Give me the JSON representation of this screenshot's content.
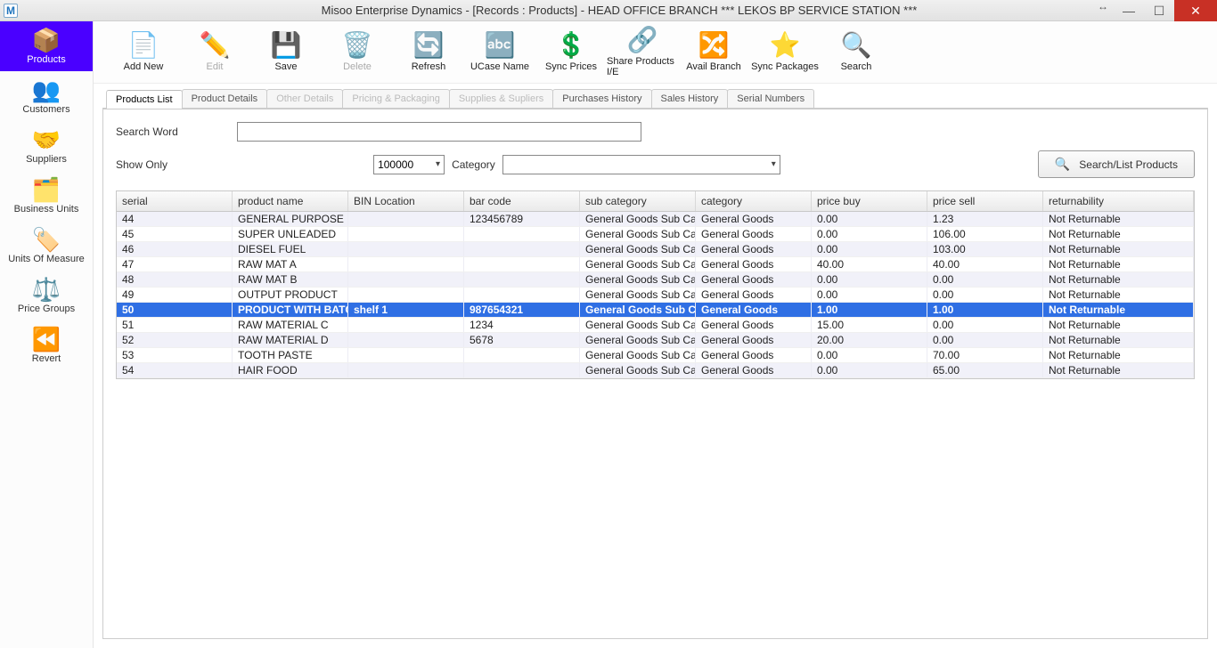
{
  "title": "Misoo Enterprise Dynamics - [Records : Products] - HEAD OFFICE BRANCH *** LEKOS BP SERVICE STATION ***",
  "sidebar": {
    "items": [
      {
        "label": "Products",
        "icon": "📦",
        "active": true
      },
      {
        "label": "Customers",
        "icon": "👥"
      },
      {
        "label": "Suppliers",
        "icon": "🤝"
      },
      {
        "label": "Business Units",
        "icon": "🗂️"
      },
      {
        "label": "Units Of Measure",
        "icon": "🏷️"
      },
      {
        "label": "Price Groups",
        "icon": "⚖️"
      },
      {
        "label": "Revert",
        "icon": "⏪"
      }
    ]
  },
  "toolbar": {
    "items": [
      {
        "label": "Add New",
        "icon": "📄",
        "accent": "#2fa52f"
      },
      {
        "label": "Edit",
        "icon": "✏️",
        "disabled": true
      },
      {
        "label": "Save",
        "icon": "💾"
      },
      {
        "label": "Delete",
        "icon": "🗑️",
        "disabled": true
      },
      {
        "label": "Refresh",
        "icon": "🔄"
      },
      {
        "label": "UCase  Name",
        "icon": "🔤"
      },
      {
        "label": "Sync Prices",
        "icon": "💲"
      },
      {
        "label": "Share Products I/E",
        "icon": "🔗"
      },
      {
        "label": "Avail Branch",
        "icon": "🔀"
      },
      {
        "label": "Sync Packages",
        "icon": "⭐"
      },
      {
        "label": "Search",
        "icon": "🔍"
      }
    ]
  },
  "tabs": [
    {
      "label": "Products List",
      "active": true
    },
    {
      "label": "Product Details"
    },
    {
      "label": "Other Details",
      "disabled": true
    },
    {
      "label": "Pricing & Packaging",
      "disabled": true
    },
    {
      "label": "Supplies & Supliers",
      "disabled": true
    },
    {
      "label": "Purchases History"
    },
    {
      "label": "Sales History"
    },
    {
      "label": "Serial Numbers"
    }
  ],
  "search": {
    "word_label": "Search Word",
    "show_only_label": "Show Only",
    "show_only_value": "100000",
    "category_label": "Category",
    "category_value": "",
    "button_label": "Search/List Products"
  },
  "columns": [
    "serial",
    "product name",
    "BIN Location",
    "bar code",
    "sub category",
    "category",
    "price buy",
    "price sell",
    "returnability"
  ],
  "rows": [
    {
      "serial": "44",
      "name": "GENERAL PURPOSE INK",
      "bin": "",
      "bar": "123456789",
      "sub": "General Goods Sub Cat...",
      "cat": "General Goods",
      "buy": "0.00",
      "sell": "1.23",
      "ret": "Not Returnable"
    },
    {
      "serial": "45",
      "name": "SUPER UNLEADED",
      "bin": "",
      "bar": "",
      "sub": "General Goods Sub Cat...",
      "cat": "General Goods",
      "buy": "0.00",
      "sell": "106.00",
      "ret": "Not Returnable"
    },
    {
      "serial": "46",
      "name": "DIESEL FUEL",
      "bin": "",
      "bar": "",
      "sub": "General Goods Sub Cat...",
      "cat": "General Goods",
      "buy": "0.00",
      "sell": "103.00",
      "ret": "Not Returnable"
    },
    {
      "serial": "47",
      "name": "RAW MAT A",
      "bin": "",
      "bar": "",
      "sub": "General Goods Sub Cat...",
      "cat": "General Goods",
      "buy": "40.00",
      "sell": "40.00",
      "ret": "Not Returnable"
    },
    {
      "serial": "48",
      "name": "RAW MAT B",
      "bin": "",
      "bar": "",
      "sub": "General Goods Sub Cat...",
      "cat": "General Goods",
      "buy": "0.00",
      "sell": "0.00",
      "ret": "Not Returnable"
    },
    {
      "serial": "49",
      "name": "OUTPUT PRODUCT",
      "bin": "",
      "bar": "",
      "sub": "General Goods Sub Cat...",
      "cat": "General Goods",
      "buy": "0.00",
      "sell": "0.00",
      "ret": "Not Returnable"
    },
    {
      "serial": "50",
      "name": "PRODUCT WITH BATCH",
      "bin": "shelf 1",
      "bar": "987654321",
      "sub": "General Goods Sub C...",
      "cat": "General Goods",
      "buy": "1.00",
      "sell": "1.00",
      "ret": "Not Returnable",
      "selected": true
    },
    {
      "serial": "51",
      "name": "RAW MATERIAL C",
      "bin": "",
      "bar": "1234",
      "sub": "General Goods Sub Cat...",
      "cat": "General Goods",
      "buy": "15.00",
      "sell": "0.00",
      "ret": "Not Returnable"
    },
    {
      "serial": "52",
      "name": "RAW MATERIAL D",
      "bin": "",
      "bar": "5678",
      "sub": "General Goods Sub Cat...",
      "cat": "General Goods",
      "buy": "20.00",
      "sell": "0.00",
      "ret": "Not Returnable"
    },
    {
      "serial": "53",
      "name": "TOOTH PASTE",
      "bin": "",
      "bar": "",
      "sub": "General Goods Sub Cat...",
      "cat": "General Goods",
      "buy": "0.00",
      "sell": "70.00",
      "ret": "Not Returnable"
    },
    {
      "serial": "54",
      "name": "HAIR FOOD",
      "bin": "",
      "bar": "",
      "sub": "General Goods Sub Cat...",
      "cat": "General Goods",
      "buy": "0.00",
      "sell": "65.00",
      "ret": "Not Returnable"
    }
  ]
}
